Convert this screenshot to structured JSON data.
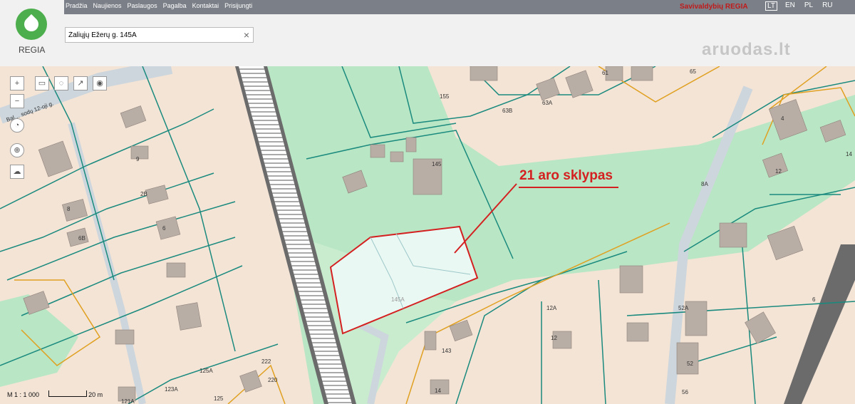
{
  "nav": {
    "items": [
      "Pradžia",
      "Naujienos",
      "Paslaugos",
      "Pagalba",
      "Kontaktai",
      "Prisijungti"
    ]
  },
  "brand": "Savivaldybių REGIA",
  "languages": [
    {
      "label": "LT",
      "active": true
    },
    {
      "label": "EN",
      "active": false
    },
    {
      "label": "PL",
      "active": false
    },
    {
      "label": "RU",
      "active": false
    }
  ],
  "logo": {
    "text": "REGIA"
  },
  "search": {
    "value": "Žaliųjų Ežerų g. 145A",
    "clear_icon": "close-icon"
  },
  "watermark": "aruodas.lt",
  "map": {
    "annotation": "21 aro sklypas",
    "scale_text": "M 1 : 1 000",
    "scale_bar": "20 m",
    "street_label": "Bal… sodų 12-oji g.",
    "parcel_labels": [
      "155",
      "145",
      "145A",
      "63B",
      "63A",
      "61",
      "65",
      "8A",
      "9",
      "2B",
      "8",
      "6B",
      "6",
      "14",
      "12",
      "4",
      "143",
      "12A",
      "12",
      "52A",
      "52",
      "56",
      "123A",
      "125A",
      "125",
      "121A",
      "222",
      "220",
      "14",
      "6"
    ]
  },
  "colors": {
    "plot_outline": "#d42020",
    "parcel_line": "#1a8a7e",
    "municipal_line": "#e0a020",
    "green": "#b9e6c4",
    "land": "#f4e4d6",
    "road": "#cdd6dc",
    "building": "#b9aea6"
  }
}
